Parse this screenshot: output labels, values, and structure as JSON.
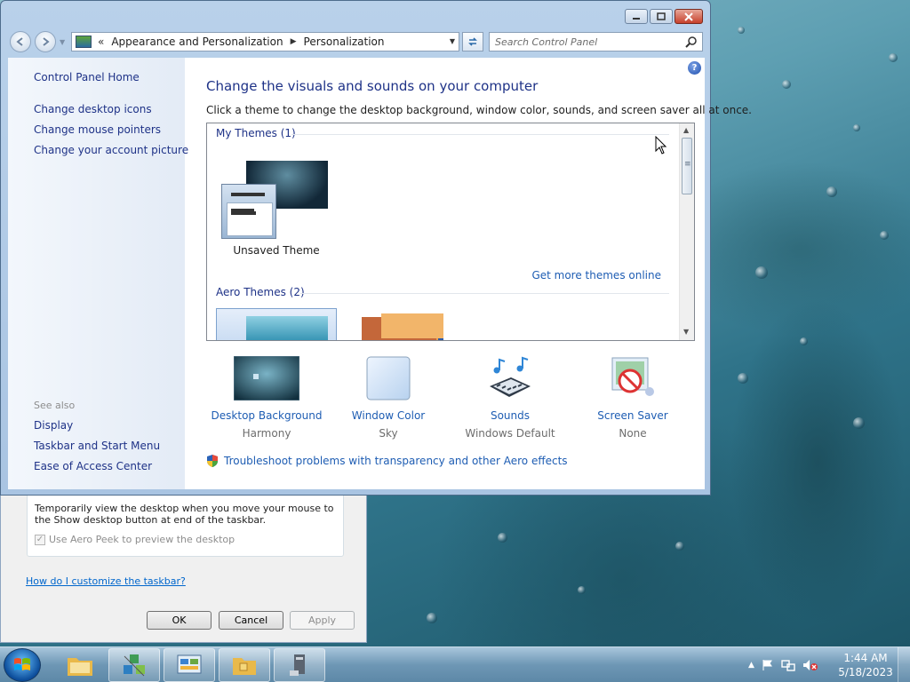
{
  "window": {
    "address": {
      "segments": [
        "Appearance and Personalization",
        "Personalization"
      ]
    },
    "search": {
      "placeholder": "Search Control Panel"
    }
  },
  "sidebar": {
    "home": "Control Panel Home",
    "links": [
      "Change desktop icons",
      "Change mouse pointers",
      "Change your account picture"
    ],
    "see_also_title": "See also",
    "see_also": [
      "Display",
      "Taskbar and Start Menu",
      "Ease of Access Center"
    ]
  },
  "main": {
    "title": "Change the visuals and sounds on your computer",
    "description": "Click a theme to change the desktop background, window color, sounds, and screen saver all at once.",
    "my_themes_label": "My Themes (1)",
    "unsaved_theme": "Unsaved Theme",
    "more_themes_link": "Get more themes online",
    "aero_themes_label": "Aero Themes (2)",
    "settings": [
      {
        "name": "Desktop Background",
        "value": "Harmony",
        "icon": "desktop-background-icon"
      },
      {
        "name": "Window Color",
        "value": "Sky",
        "icon": "window-color-icon"
      },
      {
        "name": "Sounds",
        "value": "Windows Default",
        "icon": "sounds-icon"
      },
      {
        "name": "Screen Saver",
        "value": "None",
        "icon": "screen-saver-icon"
      }
    ],
    "troubleshoot_link": "Troubleshoot problems with transparency and other Aero effects"
  },
  "taskbar_dialog": {
    "peek_text": "Temporarily view the desktop when you move your mouse to the Show desktop button at end of the taskbar.",
    "peek_checkbox": "Use Aero Peek to preview the desktop",
    "customize_link": "How do I customize the taskbar?",
    "ok": "OK",
    "cancel": "Cancel",
    "apply": "Apply"
  },
  "taskbar": {
    "time": "1:44 AM",
    "date": "5/18/2023"
  },
  "colors": {
    "link": "#1e5db3",
    "title": "#1e3287",
    "close_button": "#c7402b"
  }
}
